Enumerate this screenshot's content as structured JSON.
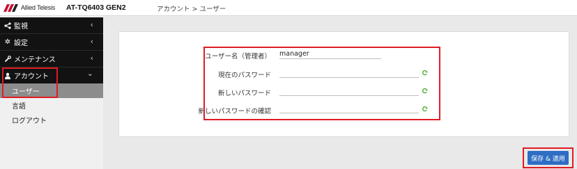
{
  "header": {
    "brand": "Allied Telesis",
    "model": "AT-TQ6403 GEN2",
    "breadcrumb": "アカウント > ユーザー"
  },
  "sidebar": {
    "items": [
      {
        "label": "監視",
        "icon": "share-icon"
      },
      {
        "label": "設定",
        "icon": "gear-icon"
      },
      {
        "label": "メンテナンス",
        "icon": "wrench-icon"
      },
      {
        "label": "アカウント",
        "icon": "user-icon"
      }
    ],
    "chevron_closed": "‹",
    "chevron_open": "⌄",
    "subitems": [
      {
        "label": "ユーザー",
        "active": true
      },
      {
        "label": "言語"
      },
      {
        "label": "ログアウト"
      }
    ]
  },
  "form": {
    "username_label": "ユーザー名（管理者）",
    "username_value": "manager",
    "current_password_label": "現在のパスワード",
    "new_password_label": "新しいパスワード",
    "confirm_password_label": "新しいパスワードの確認"
  },
  "actions": {
    "save_label": "保存 & 適用"
  },
  "colors": {
    "highlight": "#e11b22",
    "save_button": "#2e6dc4",
    "sidebar_dark": "#121212",
    "active_sub": "#8c8c8c",
    "eye_icon": "#4caf2e"
  }
}
